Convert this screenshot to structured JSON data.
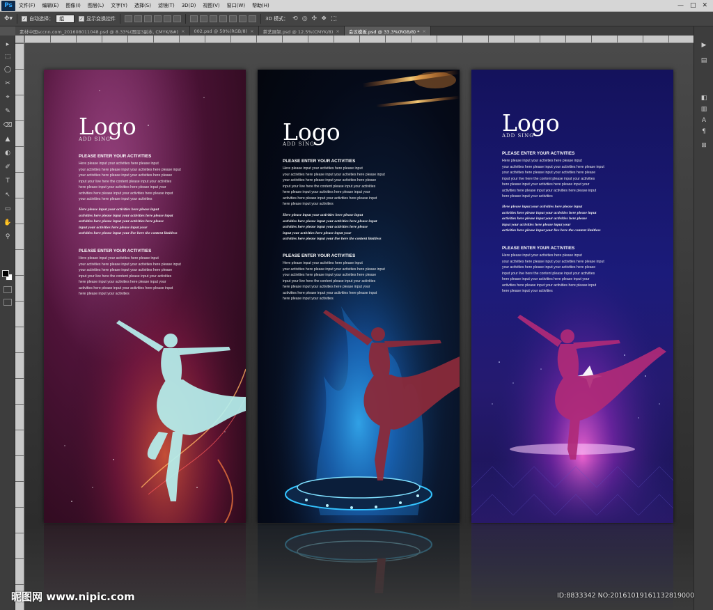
{
  "app": {
    "logo": "Ps"
  },
  "menu": [
    "文件(F)",
    "编辑(E)",
    "图像(I)",
    "图层(L)",
    "文字(Y)",
    "选择(S)",
    "滤镜(T)",
    "3D(D)",
    "视图(V)",
    "窗口(W)",
    "帮助(H)"
  ],
  "window_controls": {
    "minimize": "—",
    "restore": "□",
    "close": "✕"
  },
  "options": {
    "auto_select_label": "自动选择：",
    "auto_select_value": "组",
    "show_transform_label": "显示变换控件",
    "mode_3d_label": "3D 模式："
  },
  "tabs": [
    {
      "label": "素材中国sccnn.com_20160801104​8.psd @ 8.33%(图层3副本, CMYK/8#)",
      "active": false
    },
    {
      "label": "002.psd @ 50%(RGB/8)",
      "active": false
    },
    {
      "label": "茶艺展架.psd @ 12.5%(CMYK/8)",
      "active": false
    },
    {
      "label": "会议模板.psd @ 33.3%(RGB/8) *",
      "active": true
    }
  ],
  "tab_close": "×",
  "tools": [
    "▸",
    "⬚",
    "◯",
    "✂",
    "⌖",
    "✎",
    "⌫",
    "▲",
    "◐",
    "✐",
    "T",
    "↖",
    "▭",
    "✋",
    "⚲"
  ],
  "right_tools": [
    "▶",
    "▤",
    "◧",
    "▥",
    "A",
    "¶",
    "⊞"
  ],
  "banners": [
    {
      "logo": "Logo",
      "logo_sub": "ADD SING",
      "heading_1": "PLEASE ENTER YOUR ACTIVITIES",
      "body_1": [
        "Here please input your activities here please input",
        "your activities here please input your activities here please input",
        "your activities here please input your activities here please",
        "input your live here the content please input your activities",
        "here please input your activities here please input your",
        "activities here please input your activities here please input",
        "your activities here please input your activities"
      ],
      "italic": [
        "Here please input your activities here please input",
        "activities here please input your activities here please input",
        "activities here please input your activities here please",
        "input your activities here please input your",
        "activities here please input your live here the content limitless"
      ],
      "heading_2": "PLEASE ENTER YOUR ACTIVITIES",
      "body_2": [
        "Here please input your activities here please input",
        "your activities here please input your activities here please input",
        "your activities here please input your activities here please",
        "input your live here the content please input your activities",
        "here please input your activities here please input your",
        "activities here please input your activities here please input",
        "here please input your activities"
      ]
    },
    {
      "logo": "Logo",
      "logo_sub": "ADD SING",
      "heading_1": "PLEASE ENTER YOUR ACTIVITIES",
      "body_1": [
        "Here please input your activities here please input",
        "your activities here please input your activities here please input",
        "your activities here please input your activities here please",
        "input your live here the content please input your activities",
        "here please input your activities here please input your",
        "activities here please input your activities here please input",
        "here please input your activities"
      ],
      "italic": [
        "Here please input your activities here please input",
        "activities here please input your activities here please input",
        "activities here please input your activities here please",
        "input your activities here please input your",
        "activities here please input your live here the content limitless"
      ],
      "heading_2": "PLEASE ENTER YOUR ACTIVITIES",
      "body_2": [
        "Here please input your activities here please input",
        "your activities here please input your activities here please input",
        "your activities here please input your activities here please",
        "input your live here the content please input your activities",
        "here please input your activities here please input your",
        "activities here please input your activities here please input",
        "here please input your activities"
      ]
    },
    {
      "logo": "Logo",
      "logo_sub": "ADD SING",
      "heading_1": "PLEASE ENTER YOUR ACTIVITIES",
      "body_1": [
        "Here please input your activities here please input",
        "your activities here please input your activities here please input",
        "your activities here please input your activities here please",
        "input your live here the content please input your activities",
        "here please input your activities here please input your",
        "activities here please input your activities here please input",
        "here please input your activities"
      ],
      "italic": [
        "Here please input your activities here please input",
        "activities here please input your activities here please input",
        "activities here please input your activities here please",
        "input your activities here please input your",
        "activities here please input your live here the content limitless"
      ],
      "heading_2": "PLEASE ENTER YOUR ACTIVITIES",
      "body_2": [
        "Here please input your activities here please input",
        "your activities here please input your activities here please input",
        "your activities here please input your activities here please",
        "input your live here the content please input your activities",
        "here please input your activities here please input your",
        "activities here please input your activities here please input",
        "here please input your activities"
      ]
    }
  ],
  "watermark": {
    "left": "昵图网 www.nipic.com",
    "right": "ID:8833342 NO:20161019161132819000"
  },
  "colors": {
    "red_banner": "#4e1338",
    "dark_banner": "#0a1830",
    "blue_banner": "#1b1b7a"
  }
}
